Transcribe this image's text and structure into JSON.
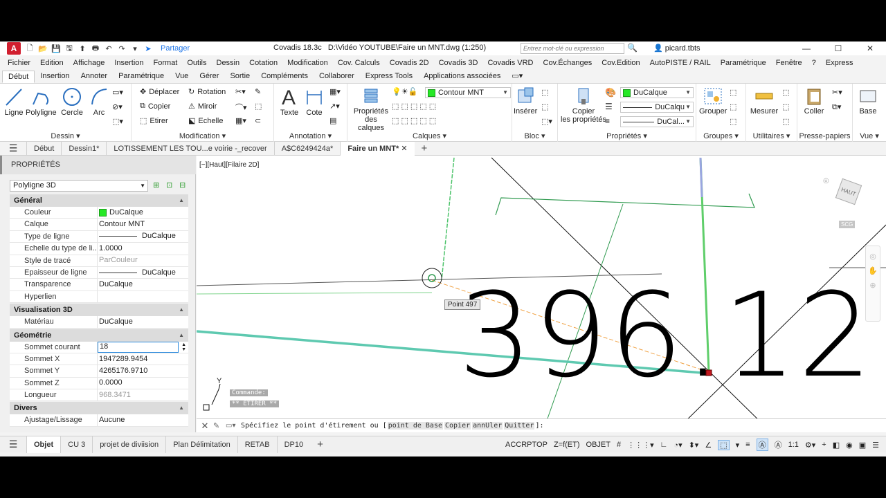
{
  "titlebar": {
    "share": "Partager",
    "app_version": "Covadis 18.3c",
    "document": "D:\\Vidéo YOUTUBE\\Faire un MNT.dwg (1:250)",
    "search_placeholder": "Entrez mot-clé ou expression",
    "user": "picard.tbts"
  },
  "menu": [
    "Fichier",
    "Edition",
    "Affichage",
    "Insertion",
    "Format",
    "Outils",
    "Dessin",
    "Cotation",
    "Modification",
    "Cov. Calculs",
    "Covadis 2D",
    "Covadis 3D",
    "Covadis VRD",
    "Cov.Échanges",
    "Cov.Edition",
    "AutoPISTE / RAIL",
    "Paramétrique",
    "Fenêtre",
    "?",
    "Express"
  ],
  "ribbon_tabs": [
    "Début",
    "Insertion",
    "Annoter",
    "Paramétrique",
    "Vue",
    "Gérer",
    "Sortie",
    "Compléments",
    "Collaborer",
    "Express Tools",
    "Applications associées"
  ],
  "ribbon": {
    "dessin": {
      "title": "Dessin",
      "ligne": "Ligne",
      "polyligne": "Polyligne",
      "cercle": "Cercle",
      "arc": "Arc"
    },
    "modification": {
      "title": "Modification",
      "deplacer": "Déplacer",
      "rotation": "Rotation",
      "copier": "Copier",
      "miroir": "Miroir",
      "etirer": "Etirer",
      "echelle": "Echelle"
    },
    "annotation": {
      "title": "Annotation",
      "texte": "Texte",
      "cote": "Cote"
    },
    "calques": {
      "title": "Calques",
      "proprietes_l1": "Propriétés",
      "proprietes_l2": "des calques",
      "current": "Contour MNT"
    },
    "bloc": {
      "title": "Bloc",
      "inserer": "Insérer"
    },
    "proprietes": {
      "title": "Propriétés",
      "copier_l1": "Copier",
      "copier_l2": "les propriétés",
      "color": "DuCalque",
      "linetype": "DuCalqu",
      "lineweight": "DuCal..."
    },
    "groupes": {
      "title": "Groupes",
      "grouper": "Grouper"
    },
    "utilitaires": {
      "title": "Utilitaires",
      "mesurer": "Mesurer"
    },
    "pressepapiers": {
      "title": "Presse-papiers",
      "coller": "Coller"
    },
    "vue": {
      "title": "Vue",
      "base": "Base"
    }
  },
  "doc_tabs": [
    "Début",
    "Dessin1*",
    "LOTISSEMENT LES TOU...e voirie -_recover",
    "A$C6249424a*",
    "Faire un MNT*"
  ],
  "properties": {
    "header": "PROPRIÉTÉS",
    "object_type": "Polyligne 3D",
    "general": {
      "title": "Général",
      "rows": [
        {
          "k": "Couleur",
          "v": "DuCalque"
        },
        {
          "k": "Calque",
          "v": "Contour MNT"
        },
        {
          "k": "Type de ligne",
          "v": "DuCalque"
        },
        {
          "k": "Echelle du type de li...",
          "v": "1.0000"
        },
        {
          "k": "Style de tracé",
          "v": "ParCouleur"
        },
        {
          "k": "Epaisseur de ligne",
          "v": "DuCalque"
        },
        {
          "k": "Transparence",
          "v": "DuCalque"
        },
        {
          "k": "Hyperlien",
          "v": ""
        }
      ]
    },
    "vis3d": {
      "title": "Visualisation 3D",
      "rows": [
        {
          "k": "Matériau",
          "v": "DuCalque"
        }
      ]
    },
    "geometrie": {
      "title": "Géométrie",
      "rows": [
        {
          "k": "Sommet courant",
          "v": "18"
        },
        {
          "k": "Sommet X",
          "v": "1947289.9454"
        },
        {
          "k": "Sommet Y",
          "v": "4265176.9710"
        },
        {
          "k": "Sommet Z",
          "v": "0.0000"
        },
        {
          "k": "Longueur",
          "v": "968.3471"
        }
      ]
    },
    "divers": {
      "title": "Divers",
      "rows": [
        {
          "k": "Ajustage/Lissage",
          "v": "Aucune"
        }
      ]
    }
  },
  "canvas": {
    "viewport_label": "[−][Haut][Filaire 2D]",
    "big_text": "396.12",
    "point_tip": "Point 497",
    "viewcube": "HAUT",
    "wcs": "SCG",
    "axis_y": "Y",
    "history": [
      "Commande:",
      "** ETIRER **"
    ]
  },
  "command": {
    "prompt": "Spécifiez le point d'étirement ou [",
    "options": [
      "point de Base",
      "Copier",
      "annUler",
      "Quitter"
    ],
    "end": "]:"
  },
  "layout_tabs": [
    "Objet",
    "CU 3",
    "projet de diviision",
    "Plan Délimitation",
    "RETAB",
    "DP10"
  ],
  "status": {
    "accrptop": "ACCRPTOP",
    "zf": "Z=f(ET)",
    "objet": "OBJET",
    "scale": "1:1"
  }
}
